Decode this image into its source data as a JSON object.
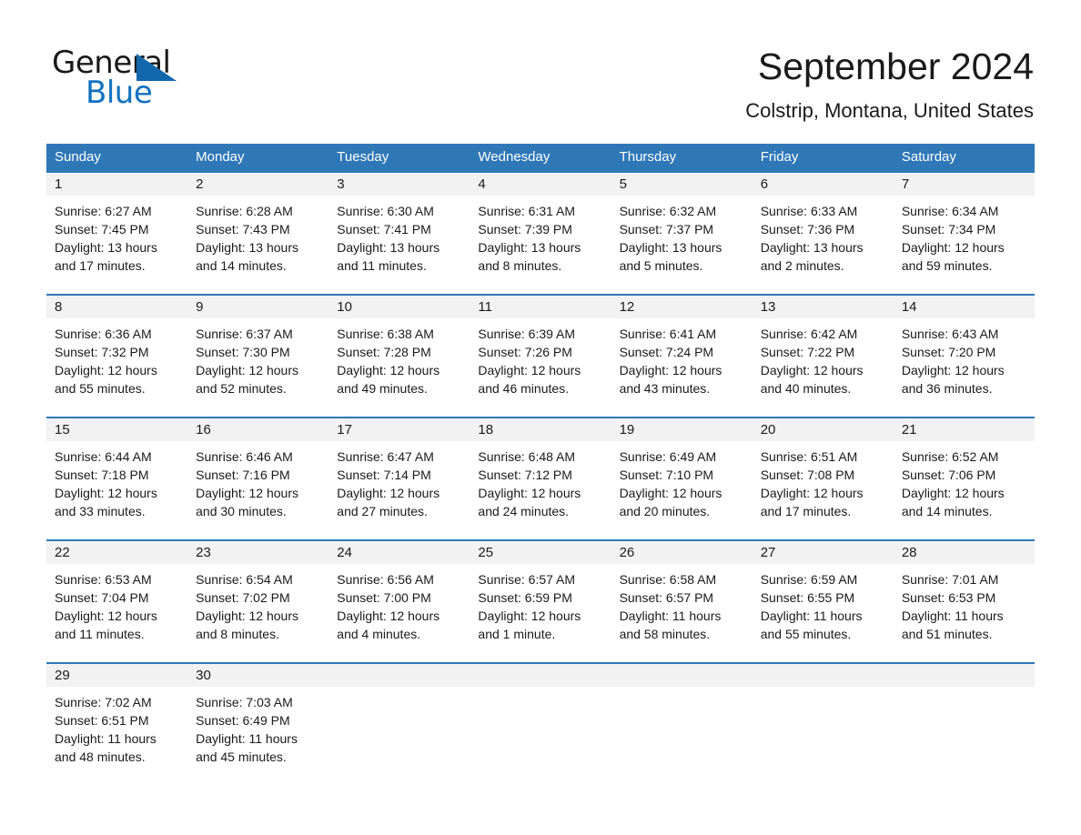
{
  "brand": {
    "logo_text_top": "General",
    "logo_text_bottom": "Blue",
    "logo_triangle_color": "#1267ad",
    "logo_blue_color": "#1272bf"
  },
  "header": {
    "month_title": "September 2024",
    "location": "Colstrip, Montana, United States"
  },
  "theme": {
    "header_blue": "#2e78b8",
    "day_band_gray": "#f2f2f2",
    "text_color": "#1a1a1a",
    "page_background": "#ffffff"
  },
  "weekdays": [
    "Sunday",
    "Monday",
    "Tuesday",
    "Wednesday",
    "Thursday",
    "Friday",
    "Saturday"
  ],
  "weeks": [
    [
      {
        "day": "1",
        "sunrise": "Sunrise: 6:27 AM",
        "sunset": "Sunset: 7:45 PM",
        "daylight_1": "Daylight: 13 hours",
        "daylight_2": "and 17 minutes."
      },
      {
        "day": "2",
        "sunrise": "Sunrise: 6:28 AM",
        "sunset": "Sunset: 7:43 PM",
        "daylight_1": "Daylight: 13 hours",
        "daylight_2": "and 14 minutes."
      },
      {
        "day": "3",
        "sunrise": "Sunrise: 6:30 AM",
        "sunset": "Sunset: 7:41 PM",
        "daylight_1": "Daylight: 13 hours",
        "daylight_2": "and 11 minutes."
      },
      {
        "day": "4",
        "sunrise": "Sunrise: 6:31 AM",
        "sunset": "Sunset: 7:39 PM",
        "daylight_1": "Daylight: 13 hours",
        "daylight_2": "and 8 minutes."
      },
      {
        "day": "5",
        "sunrise": "Sunrise: 6:32 AM",
        "sunset": "Sunset: 7:37 PM",
        "daylight_1": "Daylight: 13 hours",
        "daylight_2": "and 5 minutes."
      },
      {
        "day": "6",
        "sunrise": "Sunrise: 6:33 AM",
        "sunset": "Sunset: 7:36 PM",
        "daylight_1": "Daylight: 13 hours",
        "daylight_2": "and 2 minutes."
      },
      {
        "day": "7",
        "sunrise": "Sunrise: 6:34 AM",
        "sunset": "Sunset: 7:34 PM",
        "daylight_1": "Daylight: 12 hours",
        "daylight_2": "and 59 minutes."
      }
    ],
    [
      {
        "day": "8",
        "sunrise": "Sunrise: 6:36 AM",
        "sunset": "Sunset: 7:32 PM",
        "daylight_1": "Daylight: 12 hours",
        "daylight_2": "and 55 minutes."
      },
      {
        "day": "9",
        "sunrise": "Sunrise: 6:37 AM",
        "sunset": "Sunset: 7:30 PM",
        "daylight_1": "Daylight: 12 hours",
        "daylight_2": "and 52 minutes."
      },
      {
        "day": "10",
        "sunrise": "Sunrise: 6:38 AM",
        "sunset": "Sunset: 7:28 PM",
        "daylight_1": "Daylight: 12 hours",
        "daylight_2": "and 49 minutes."
      },
      {
        "day": "11",
        "sunrise": "Sunrise: 6:39 AM",
        "sunset": "Sunset: 7:26 PM",
        "daylight_1": "Daylight: 12 hours",
        "daylight_2": "and 46 minutes."
      },
      {
        "day": "12",
        "sunrise": "Sunrise: 6:41 AM",
        "sunset": "Sunset: 7:24 PM",
        "daylight_1": "Daylight: 12 hours",
        "daylight_2": "and 43 minutes."
      },
      {
        "day": "13",
        "sunrise": "Sunrise: 6:42 AM",
        "sunset": "Sunset: 7:22 PM",
        "daylight_1": "Daylight: 12 hours",
        "daylight_2": "and 40 minutes."
      },
      {
        "day": "14",
        "sunrise": "Sunrise: 6:43 AM",
        "sunset": "Sunset: 7:20 PM",
        "daylight_1": "Daylight: 12 hours",
        "daylight_2": "and 36 minutes."
      }
    ],
    [
      {
        "day": "15",
        "sunrise": "Sunrise: 6:44 AM",
        "sunset": "Sunset: 7:18 PM",
        "daylight_1": "Daylight: 12 hours",
        "daylight_2": "and 33 minutes."
      },
      {
        "day": "16",
        "sunrise": "Sunrise: 6:46 AM",
        "sunset": "Sunset: 7:16 PM",
        "daylight_1": "Daylight: 12 hours",
        "daylight_2": "and 30 minutes."
      },
      {
        "day": "17",
        "sunrise": "Sunrise: 6:47 AM",
        "sunset": "Sunset: 7:14 PM",
        "daylight_1": "Daylight: 12 hours",
        "daylight_2": "and 27 minutes."
      },
      {
        "day": "18",
        "sunrise": "Sunrise: 6:48 AM",
        "sunset": "Sunset: 7:12 PM",
        "daylight_1": "Daylight: 12 hours",
        "daylight_2": "and 24 minutes."
      },
      {
        "day": "19",
        "sunrise": "Sunrise: 6:49 AM",
        "sunset": "Sunset: 7:10 PM",
        "daylight_1": "Daylight: 12 hours",
        "daylight_2": "and 20 minutes."
      },
      {
        "day": "20",
        "sunrise": "Sunrise: 6:51 AM",
        "sunset": "Sunset: 7:08 PM",
        "daylight_1": "Daylight: 12 hours",
        "daylight_2": "and 17 minutes."
      },
      {
        "day": "21",
        "sunrise": "Sunrise: 6:52 AM",
        "sunset": "Sunset: 7:06 PM",
        "daylight_1": "Daylight: 12 hours",
        "daylight_2": "and 14 minutes."
      }
    ],
    [
      {
        "day": "22",
        "sunrise": "Sunrise: 6:53 AM",
        "sunset": "Sunset: 7:04 PM",
        "daylight_1": "Daylight: 12 hours",
        "daylight_2": "and 11 minutes."
      },
      {
        "day": "23",
        "sunrise": "Sunrise: 6:54 AM",
        "sunset": "Sunset: 7:02 PM",
        "daylight_1": "Daylight: 12 hours",
        "daylight_2": "and 8 minutes."
      },
      {
        "day": "24",
        "sunrise": "Sunrise: 6:56 AM",
        "sunset": "Sunset: 7:00 PM",
        "daylight_1": "Daylight: 12 hours",
        "daylight_2": "and 4 minutes."
      },
      {
        "day": "25",
        "sunrise": "Sunrise: 6:57 AM",
        "sunset": "Sunset: 6:59 PM",
        "daylight_1": "Daylight: 12 hours",
        "daylight_2": "and 1 minute."
      },
      {
        "day": "26",
        "sunrise": "Sunrise: 6:58 AM",
        "sunset": "Sunset: 6:57 PM",
        "daylight_1": "Daylight: 11 hours",
        "daylight_2": "and 58 minutes."
      },
      {
        "day": "27",
        "sunrise": "Sunrise: 6:59 AM",
        "sunset": "Sunset: 6:55 PM",
        "daylight_1": "Daylight: 11 hours",
        "daylight_2": "and 55 minutes."
      },
      {
        "day": "28",
        "sunrise": "Sunrise: 7:01 AM",
        "sunset": "Sunset: 6:53 PM",
        "daylight_1": "Daylight: 11 hours",
        "daylight_2": "and 51 minutes."
      }
    ],
    [
      {
        "day": "29",
        "sunrise": "Sunrise: 7:02 AM",
        "sunset": "Sunset: 6:51 PM",
        "daylight_1": "Daylight: 11 hours",
        "daylight_2": "and 48 minutes."
      },
      {
        "day": "30",
        "sunrise": "Sunrise: 7:03 AM",
        "sunset": "Sunset: 6:49 PM",
        "daylight_1": "Daylight: 11 hours",
        "daylight_2": "and 45 minutes."
      },
      {
        "day": "",
        "sunrise": "",
        "sunset": "",
        "daylight_1": "",
        "daylight_2": ""
      },
      {
        "day": "",
        "sunrise": "",
        "sunset": "",
        "daylight_1": "",
        "daylight_2": ""
      },
      {
        "day": "",
        "sunrise": "",
        "sunset": "",
        "daylight_1": "",
        "daylight_2": ""
      },
      {
        "day": "",
        "sunrise": "",
        "sunset": "",
        "daylight_1": "",
        "daylight_2": ""
      },
      {
        "day": "",
        "sunrise": "",
        "sunset": "",
        "daylight_1": "",
        "daylight_2": ""
      }
    ]
  ]
}
